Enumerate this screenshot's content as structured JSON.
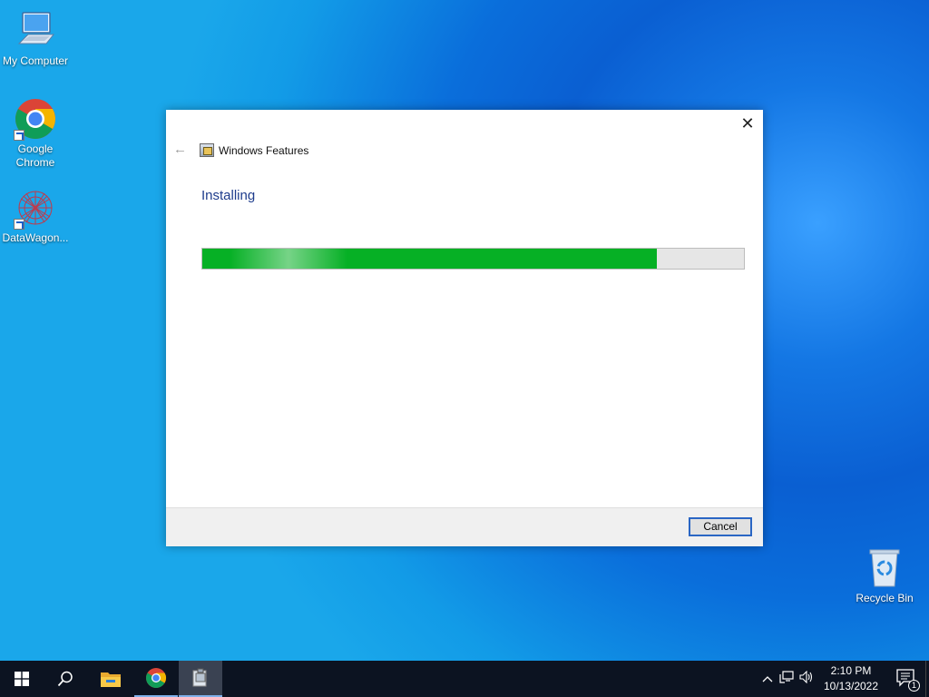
{
  "desktop": {
    "icons": [
      {
        "label": "My Computer",
        "icon": "computer-icon"
      },
      {
        "label": "Google Chrome",
        "icon": "chrome-icon"
      },
      {
        "label": "DataWagon...",
        "icon": "datawagon-icon"
      },
      {
        "label": "Recycle Bin",
        "icon": "recycle-bin-icon"
      }
    ]
  },
  "dialog": {
    "title": "Windows Features",
    "heading": "Installing",
    "progress_percent": 84,
    "cancel_label": "Cancel",
    "close_glyph": "✕",
    "back_glyph": "←"
  },
  "taskbar": {
    "buttons": [
      "start-icon",
      "search-icon",
      "file-explorer-icon",
      "chrome-icon",
      "windows-features-icon"
    ],
    "tray": {
      "time": "2:10 PM",
      "date": "10/13/2022",
      "notification_count": "1"
    }
  },
  "colors": {
    "progress_fill": "#06b025",
    "heading": "#1e3c8c",
    "focus_border": "#2a66c4"
  }
}
